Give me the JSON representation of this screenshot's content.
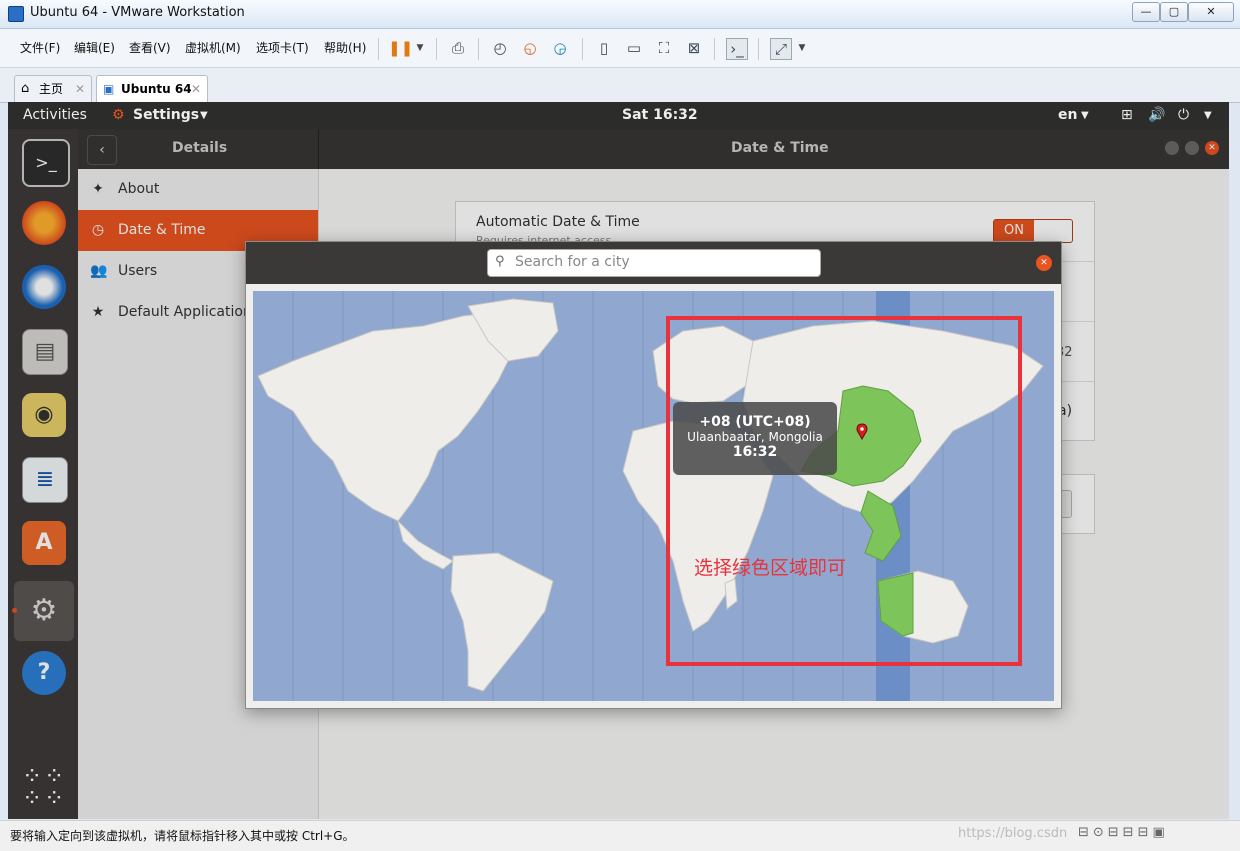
{
  "vmware": {
    "window_title": "Ubuntu 64  - VMware Workstation",
    "menu": [
      "文件(F)",
      "编辑(E)",
      "查看(V)",
      "虚拟机(M)",
      "选项卡(T)",
      "帮助(H)"
    ],
    "tabs": [
      {
        "label": "主页",
        "icon": "home-icon"
      },
      {
        "label": "Ubuntu 64",
        "icon": "vm-icon"
      }
    ],
    "status_text": "要将输入定向到该虚拟机，请将鼠标指针移入其中或按 Ctrl+G。",
    "watermark": "https://blog.csdn"
  },
  "ubuntu": {
    "activities": "Activities",
    "app_menu": "Settings",
    "clock": "Sat 16:32",
    "lang": "en",
    "dock_icons": [
      "terminal-icon",
      "firefox-icon",
      "thunderbird-icon",
      "files-icon",
      "rhythmbox-icon",
      "writer-icon",
      "software-icon",
      "settings-icon",
      "help-icon",
      "apps-grid-icon"
    ]
  },
  "settings": {
    "sidebar_title": "Details",
    "page_title": "Date & Time",
    "items": [
      {
        "label": "About",
        "icon": "star-icon"
      },
      {
        "label": "Date & Time",
        "icon": "clock-icon",
        "active": true
      },
      {
        "label": "Users",
        "icon": "users-icon"
      },
      {
        "label": "Default Application",
        "icon": "star-icon"
      }
    ],
    "automatic_label": "Automatic Date & Time",
    "automatic_sub": "Requires internet access",
    "toggle": "ON",
    "partial_right_1": "32",
    "partial_right_2": "a)"
  },
  "timezone_dialog": {
    "search_placeholder": "Search for a city",
    "tooltip": {
      "offset": "+08 (UTC+08)",
      "city": "Ulaanbaatar, Mongolia",
      "time": "16:32"
    },
    "annotation": "选择绿色区域即可"
  },
  "colors": {
    "accent": "#e95420",
    "map_water": "#90a8cf",
    "land": "#efedea",
    "selected_zone": "#7dc55a",
    "annotation_red": "#e8333c"
  }
}
